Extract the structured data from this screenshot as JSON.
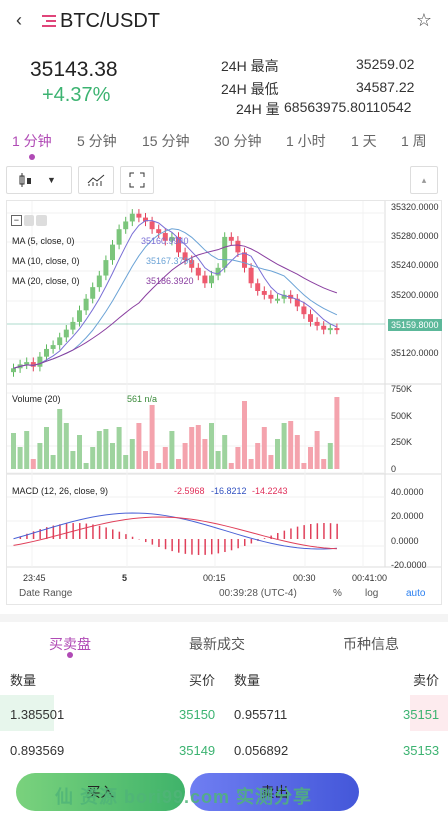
{
  "header": {
    "title": "BTC/USDT"
  },
  "summary": {
    "price": "35143.38",
    "change": "+4.37%",
    "high_label": "24H 最高",
    "high_value": "35259.02",
    "low_label": "24H 最低",
    "low_value": "34587.22",
    "vol_label": "24H 量",
    "vol_value": "68563975.80110542"
  },
  "timeframes": [
    "1 分钟",
    "5 分钟",
    "15 分钟",
    "30 分钟",
    "1 小时",
    "1 天",
    "1 周"
  ],
  "chart": {
    "legend": {
      "ma5": "MA (5, close, 0)",
      "ma5_val": "35160.9940",
      "ma10": "MA (10, close, 0)",
      "ma10_val": "35167.3790",
      "ma20": "MA (20, close, 0)",
      "ma20_val": "35186.3920",
      "volume": "Volume (20)",
      "volume_val": "561  n/a",
      "macd": "MACD (12, 26, close, 9)",
      "macd_v1": "-2.5968",
      "macd_v2": "-16.8212",
      "macd_v3": "-14.2243"
    },
    "price_axis": [
      "35320.0000",
      "35280.0000",
      "35240.0000",
      "35200.0000",
      "35159.8000",
      "35120.0000"
    ],
    "vol_axis": [
      "750K",
      "500K",
      "250K",
      "0"
    ],
    "macd_axis": [
      "40.0000",
      "20.0000",
      "0.0000",
      "-20.0000"
    ],
    "time_axis": [
      "23:45",
      "5",
      "00:15",
      "00:30",
      "00:41:00"
    ],
    "footer": {
      "date_range": "Date Range",
      "time": "00:39:28 (UTC-4)",
      "pct": "%",
      "log": "log",
      "auto": "auto"
    }
  },
  "tabs": [
    "买卖盘",
    "最新成交",
    "币种信息"
  ],
  "orderbook": {
    "headers": [
      "数量",
      "买价",
      "数量",
      "卖价"
    ],
    "rows": [
      [
        "1.385501",
        "35150",
        "0.955711",
        "35151"
      ],
      [
        "0.893569",
        "35149",
        "0.056892",
        "35153"
      ]
    ]
  },
  "actions": {
    "buy": "买入",
    "sell": "卖出",
    "watermark": "仙 资源  bori99.com  实测分享"
  },
  "colors": {
    "accent": "#b04ab5",
    "up": "#3cb371",
    "down": "#e0457a"
  },
  "chart_data": {
    "type": "candlestick",
    "title": "BTC/USDT 1 分钟",
    "x": [
      "23:45",
      "5",
      "00:15",
      "00:30",
      "00:41:00"
    ],
    "ylim": [
      35100,
      35330
    ],
    "series": [
      {
        "name": "MA (5, close, 0)",
        "last": 35160.994
      },
      {
        "name": "MA (10, close, 0)",
        "last": 35167.379
      },
      {
        "name": "MA (20, close, 0)",
        "last": 35186.392
      }
    ],
    "current_price": 35159.8
  }
}
